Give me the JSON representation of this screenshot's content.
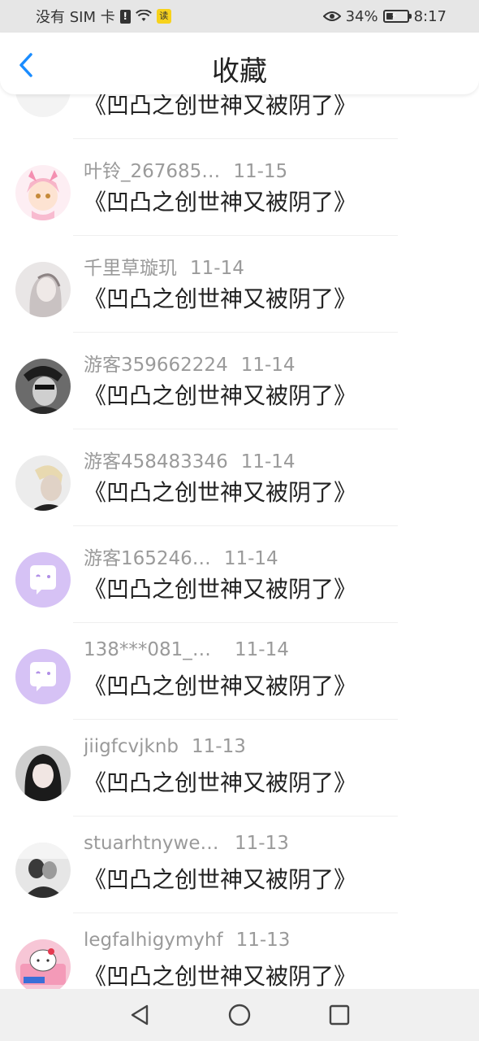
{
  "status_bar": {
    "carrier": "没有 SIM 卡",
    "sim_alert": "!",
    "app_badge": "读",
    "battery_percent": "34%",
    "battery_level": 0.34,
    "time": "8:17"
  },
  "header": {
    "title": "收藏",
    "back_icon": "chevron-left-icon",
    "accent_color": "#1a8cff"
  },
  "items": [
    {
      "name": "",
      "date": "",
      "title": "《凹凸之创世神又被阴了》",
      "avatar": "rose"
    },
    {
      "name": "叶铃_267685…",
      "date": "11-15",
      "title": "《凹凸之创世神又被阴了》",
      "avatar": "anime-girl-pink"
    },
    {
      "name": "千里草璇玑",
      "date": "11-14",
      "title": "《凹凸之创世神又被阴了》",
      "avatar": "sketch-girl"
    },
    {
      "name": "游客359662224",
      "date": "11-14",
      "title": "《凹凸之创世神又被阴了》",
      "avatar": "bw-man"
    },
    {
      "name": "游客458483346",
      "date": "11-14",
      "title": "《凹凸之创世神又被阴了》",
      "avatar": "blond-boy"
    },
    {
      "name": "游客165246…",
      "date": "11-14",
      "title": "《凹凸之创世神又被阴了》",
      "avatar": "default-chat"
    },
    {
      "name": "138***081_4…",
      "date": "11-14",
      "title": "《凹凸之创世神又被阴了》",
      "avatar": "default-chat"
    },
    {
      "name": "jiigfcvjknb",
      "date": "11-13",
      "title": "《凹凸之创世神又被阴了》",
      "avatar": "dark-hair-girl"
    },
    {
      "name": "stuarhtnywei…",
      "date": "11-13",
      "title": "《凹凸之创世神又被阴了》",
      "avatar": "couple-photo"
    },
    {
      "name": "legfalhigymyhf",
      "date": "11-13",
      "title": "《凹凸之创世神又被阴了》",
      "avatar": "hello-kitty-virgo"
    }
  ],
  "nav_bar": {
    "back": "triangle-back-icon",
    "home": "circle-home-icon",
    "recents": "square-recents-icon"
  }
}
